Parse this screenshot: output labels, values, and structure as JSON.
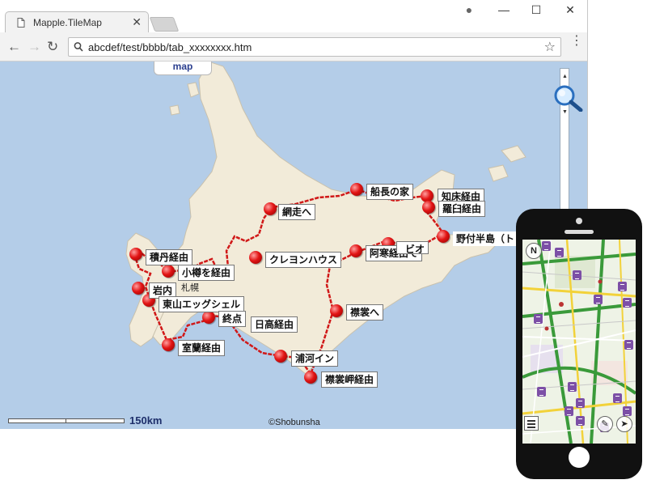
{
  "browser": {
    "tab_title": "Mapple.TileMap",
    "tab_close": "✕",
    "url": "abcdef/test/bbbb/tab_xxxxxxxx.htm",
    "window_controls": {
      "account": "●",
      "minimize": "—",
      "maximize": "☐",
      "close": "✕"
    },
    "nav": {
      "back": "←",
      "forward": "→",
      "reload": "↻"
    },
    "star": "☆",
    "menu": "⋮"
  },
  "map": {
    "tab_label": "map",
    "scale_label": "150km",
    "copyright": "©Shobunsha",
    "city_label": "札幌",
    "route_color": "#d01818",
    "land_color": "#f2ebd9",
    "sea_color": "#b4cde8",
    "places": [
      {
        "label": "網走へ"
      },
      {
        "label": "船長の家"
      },
      {
        "label": "知床経由"
      },
      {
        "label": "羅臼経由"
      },
      {
        "label": "野付半島（トド"
      },
      {
        "label": "積丹経由"
      },
      {
        "label": "小樽を経由"
      },
      {
        "label": "クレヨンハウス"
      },
      {
        "label": "阿寒経由で"
      },
      {
        "label": "ビオ"
      },
      {
        "label": "岩内"
      },
      {
        "label": "東山エッグシェル"
      },
      {
        "label": "襟裳へ"
      },
      {
        "label": "終点"
      },
      {
        "label": "日高経由"
      },
      {
        "label": "室蘭経由"
      },
      {
        "label": "浦河イン"
      },
      {
        "label": "襟裳岬経由"
      }
    ]
  },
  "phone": {
    "compass_label": "N",
    "map_colors": {
      "road_green": "#3a9a3a",
      "road_yellow": "#f2d23a",
      "poi_purple": "#7c4fa6"
    }
  }
}
